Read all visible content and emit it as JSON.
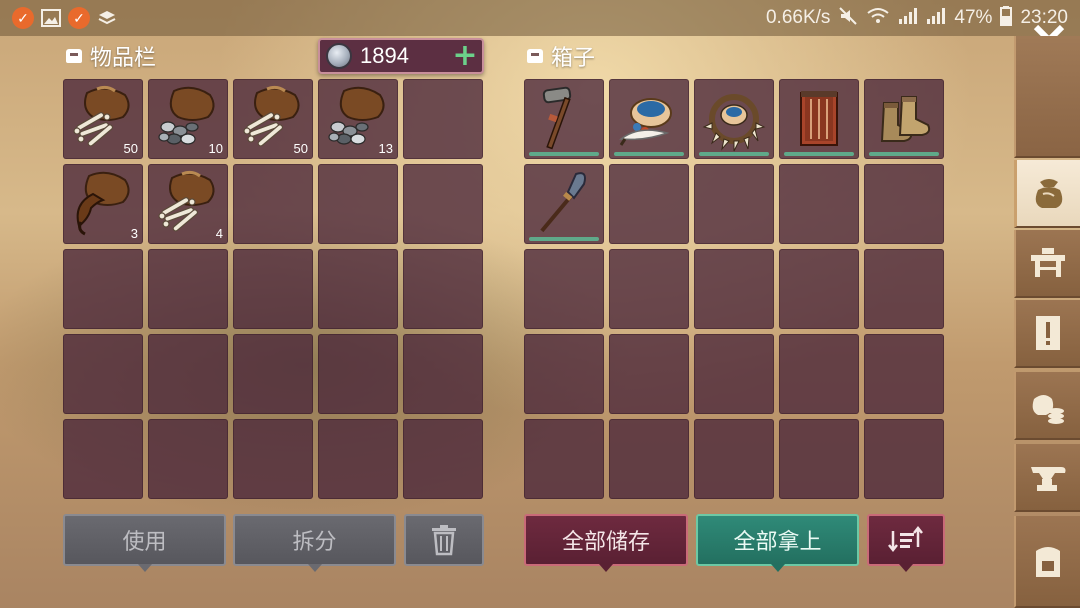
{
  "status_bar": {
    "notification_icons": [
      "app-badge-icon",
      "gallery-icon",
      "app-badge-icon",
      "layers-icon"
    ],
    "speed": "0.66K/s",
    "battery": "47%",
    "time": "23:20"
  },
  "inventory": {
    "title": "物品栏",
    "currency": {
      "value": "1894",
      "add_symbol": "+"
    },
    "slots": [
      {
        "icon": "bone-sack-icon",
        "qty": "50"
      },
      {
        "icon": "stone-sack-icon",
        "qty": "10"
      },
      {
        "icon": "bone-sack-icon",
        "qty": "50"
      },
      {
        "icon": "stone-sack-icon",
        "qty": "13"
      },
      {
        "icon": "",
        "qty": ""
      },
      {
        "icon": "claw-sack-icon",
        "qty": "3"
      },
      {
        "icon": "bone-sack-icon",
        "qty": "4"
      }
    ],
    "buttons": {
      "use": "使用",
      "split": "拆分"
    }
  },
  "box": {
    "title": "箱子",
    "slots": [
      {
        "icon": "hammer-icon",
        "durability": 1.0
      },
      {
        "icon": "paint-bowl-icon",
        "durability": 1.0
      },
      {
        "icon": "tooth-necklace-icon",
        "durability": 1.0
      },
      {
        "icon": "armor-vest-icon",
        "durability": 1.0
      },
      {
        "icon": "boots-icon",
        "durability": 1.0
      },
      {
        "icon": "spear-icon",
        "durability": 1.0
      }
    ],
    "buttons": {
      "store_all": "全部储存",
      "take_all": "全部拿上"
    }
  },
  "sidebar": {
    "tabs": [
      "bag-icon",
      "workbench-icon",
      "quest-scroll-icon",
      "resources-icon",
      "anvil-icon",
      "backpack-icon"
    ],
    "active": "bag-icon"
  },
  "colors": {
    "slot": "#4a263a",
    "accent_green": "#6cd18a",
    "durability": "#5fa98a"
  }
}
